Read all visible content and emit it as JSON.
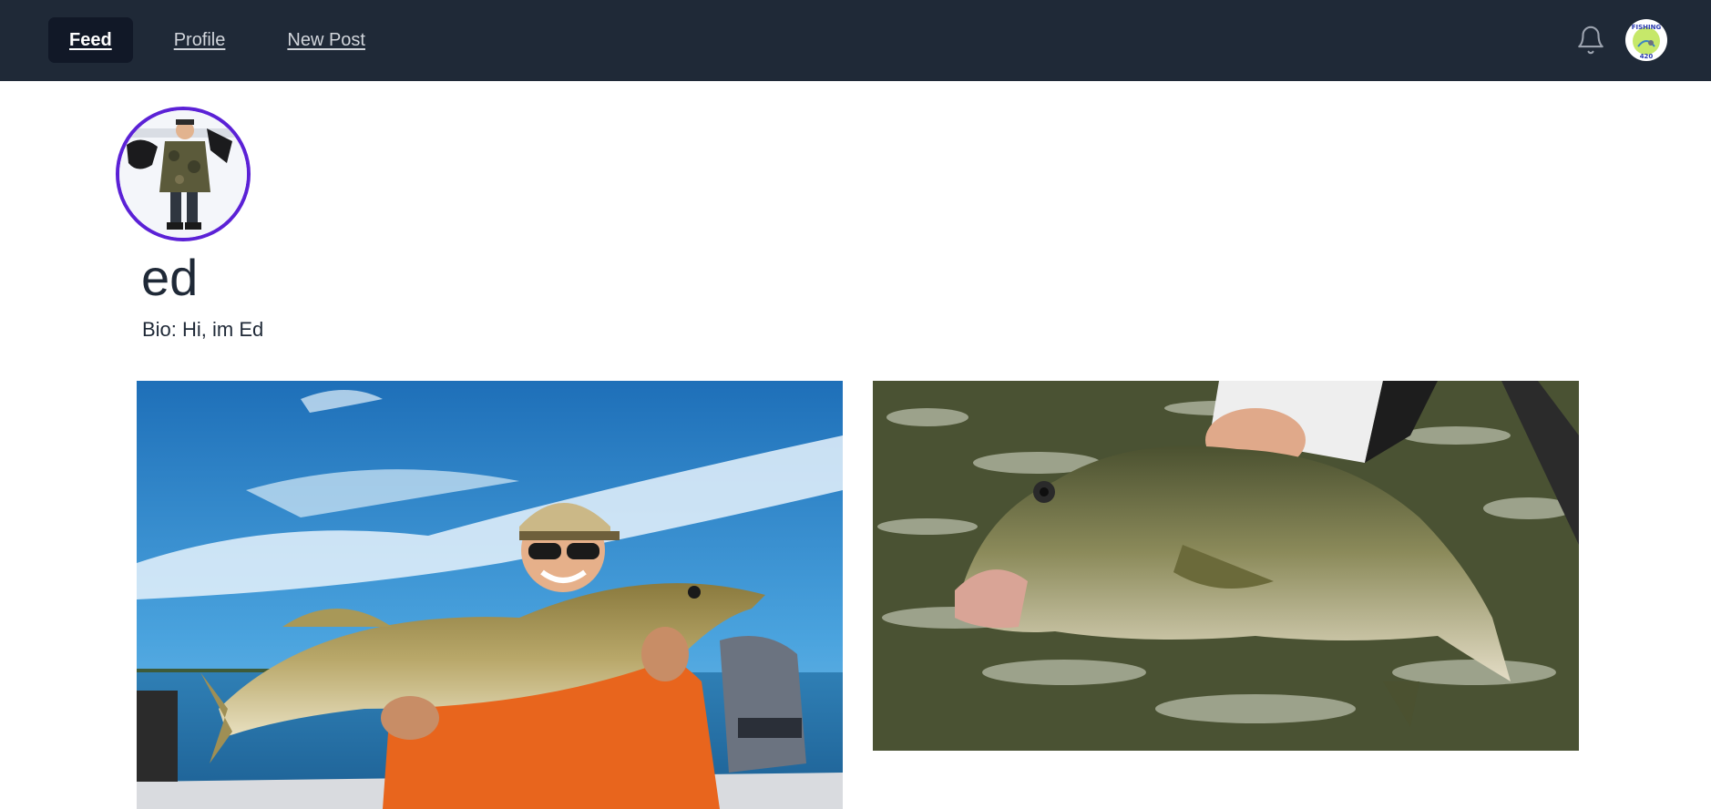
{
  "nav": {
    "links": [
      {
        "label": "Feed",
        "active": true
      },
      {
        "label": "Profile",
        "active": false
      },
      {
        "label": "New Post",
        "active": false
      }
    ],
    "notification_icon": "bell-icon",
    "avatar_text_top": "FISHING",
    "avatar_text_bottom": "420"
  },
  "profile": {
    "username": "ed",
    "bio": "Bio: Hi, im Ed"
  },
  "posts": [
    {
      "alt": "angler holding walleye on boat"
    },
    {
      "alt": "hand holding largemouth bass over water"
    }
  ],
  "colors": {
    "navbar": "#1f2937",
    "nav_active": "#111827",
    "avatar_ring": "#5b21d6"
  }
}
